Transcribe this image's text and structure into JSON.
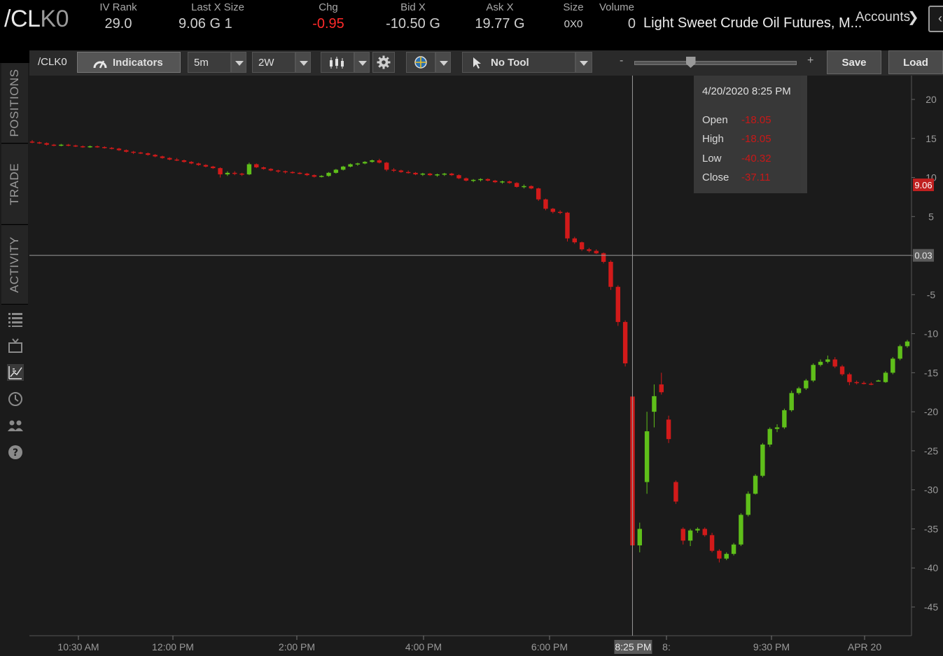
{
  "header": {
    "symbol_main": "/CL",
    "symbol_dim": "K0",
    "iv_rank_label": "IV Rank",
    "iv_rank_value": "29.0",
    "last_label": "Last X Size",
    "last_value": "9.06 G 1",
    "chg_label": "Chg",
    "chg_value": "-0.95",
    "bid_label": "Bid X",
    "bid_value": "-10.50 G",
    "ask_label": "Ask X",
    "ask_value": "19.77 G",
    "size_label": "Size",
    "size_value": "0X0",
    "volume_label": "Volume",
    "volume_value": "0",
    "description": "Light Sweet Crude Oil Futures, M...",
    "accounts_label": "Accounts"
  },
  "sidebar": {
    "tabs": [
      "POSITIONS",
      "TRADE",
      "ACTIVITY"
    ]
  },
  "toolbar": {
    "symbol": "/CLK0",
    "indicators_label": "Indicators",
    "aggregation": "5m",
    "time_frame": "2W",
    "drawing_tool": "No Tool",
    "zoom_minus": "-",
    "zoom_plus": "+",
    "zoom_level": 0.35,
    "save_label": "Save",
    "load_label": "Load"
  },
  "tooltip": {
    "date": "4/20/2020 8:25 PM",
    "open_label": "Open",
    "open_value": "-18.05",
    "high_label": "High",
    "high_value": "-18.05",
    "low_label": "Low",
    "low_value": "-40.32",
    "close_label": "Close",
    "close_value": "-37.11"
  },
  "colors": {
    "up": "#5fbf1a",
    "down": "#d21a1a",
    "last_price_badge": "#c02020",
    "crosshair_badge": "#5a5a5a"
  },
  "chart_data": {
    "type": "candlestick",
    "title": "/CLK0",
    "y_ticks": [
      20,
      15,
      10,
      5,
      0,
      -5,
      -10,
      -15,
      -20,
      -25,
      -30,
      -35,
      -40,
      -45
    ],
    "ylim": [
      -48,
      23
    ],
    "x_ticks": [
      "10:30 AM",
      "12:00 PM",
      "2:00 PM",
      "4:00 PM",
      "6:00 PM",
      "8:",
      "9:30 PM",
      "APR 20"
    ],
    "crosshair_x_label": "8:25 PM",
    "crosshair_y_label": "0.03",
    "last_price_label": "9.06",
    "candles": [
      [
        14.6,
        14.8,
        14.4,
        14.5
      ],
      [
        14.5,
        14.6,
        14.3,
        14.4
      ],
      [
        14.4,
        14.5,
        14.1,
        14.2
      ],
      [
        14.2,
        14.3,
        14.0,
        14.1
      ],
      [
        14.1,
        14.3,
        14.0,
        14.2
      ],
      [
        14.2,
        14.3,
        14.0,
        14.1
      ],
      [
        14.1,
        14.2,
        13.9,
        14.0
      ],
      [
        14.0,
        14.1,
        13.8,
        13.9
      ],
      [
        13.9,
        14.1,
        13.8,
        14.0
      ],
      [
        14.0,
        14.1,
        13.8,
        13.9
      ],
      [
        13.9,
        14.0,
        13.7,
        13.8
      ],
      [
        13.8,
        13.9,
        13.6,
        13.7
      ],
      [
        13.7,
        13.8,
        13.4,
        13.5
      ],
      [
        13.5,
        13.6,
        13.2,
        13.3
      ],
      [
        13.3,
        13.4,
        13.0,
        13.2
      ],
      [
        13.2,
        13.3,
        13.0,
        13.1
      ],
      [
        13.1,
        13.2,
        12.8,
        12.9
      ],
      [
        12.9,
        13.0,
        12.6,
        12.7
      ],
      [
        12.7,
        12.8,
        12.4,
        12.5
      ],
      [
        12.5,
        12.6,
        12.2,
        12.3
      ],
      [
        12.3,
        12.5,
        12.1,
        12.2
      ],
      [
        12.2,
        12.3,
        11.9,
        12.0
      ],
      [
        12.0,
        12.1,
        11.7,
        11.8
      ],
      [
        11.8,
        11.9,
        11.5,
        11.6
      ],
      [
        11.6,
        11.7,
        11.3,
        11.4
      ],
      [
        11.4,
        11.5,
        11.1,
        11.2
      ],
      [
        11.2,
        11.3,
        10.0,
        10.4
      ],
      [
        10.4,
        10.8,
        10.2,
        10.6
      ],
      [
        10.6,
        10.8,
        10.3,
        10.5
      ],
      [
        10.5,
        10.6,
        10.2,
        10.4
      ],
      [
        10.4,
        11.9,
        10.3,
        11.7
      ],
      [
        11.7,
        11.8,
        11.2,
        11.3
      ],
      [
        11.3,
        11.4,
        11.0,
        11.1
      ],
      [
        11.1,
        11.2,
        10.8,
        10.9
      ],
      [
        10.9,
        11.0,
        10.6,
        10.8
      ],
      [
        10.8,
        10.9,
        10.5,
        10.7
      ],
      [
        10.7,
        10.8,
        10.5,
        10.6
      ],
      [
        10.6,
        10.7,
        10.4,
        10.5
      ],
      [
        10.5,
        10.6,
        10.2,
        10.3
      ],
      [
        10.3,
        10.4,
        10.0,
        10.1
      ],
      [
        10.1,
        10.3,
        10.0,
        10.2
      ],
      [
        10.2,
        10.7,
        10.1,
        10.6
      ],
      [
        10.6,
        11.1,
        10.5,
        11.0
      ],
      [
        11.0,
        11.5,
        10.9,
        11.4
      ],
      [
        11.4,
        11.8,
        11.3,
        11.7
      ],
      [
        11.7,
        11.9,
        11.5,
        11.8
      ],
      [
        11.8,
        12.1,
        11.7,
        12.0
      ],
      [
        12.0,
        12.3,
        11.9,
        12.2
      ],
      [
        12.2,
        12.4,
        11.8,
        11.9
      ],
      [
        11.9,
        12.0,
        10.8,
        11.0
      ],
      [
        11.0,
        11.2,
        10.7,
        10.9
      ],
      [
        10.9,
        11.0,
        10.6,
        10.7
      ],
      [
        10.7,
        10.9,
        10.5,
        10.6
      ],
      [
        10.6,
        10.7,
        10.3,
        10.4
      ],
      [
        10.4,
        10.6,
        10.2,
        10.5
      ],
      [
        10.5,
        10.6,
        10.2,
        10.3
      ],
      [
        10.3,
        10.5,
        10.1,
        10.4
      ],
      [
        10.4,
        10.6,
        10.2,
        10.5
      ],
      [
        10.5,
        10.6,
        10.2,
        10.3
      ],
      [
        10.3,
        10.4,
        9.8,
        9.9
      ],
      [
        9.9,
        10.0,
        9.5,
        9.6
      ],
      [
        9.6,
        9.8,
        9.4,
        9.7
      ],
      [
        9.7,
        9.9,
        9.5,
        9.8
      ],
      [
        9.8,
        9.9,
        9.5,
        9.6
      ],
      [
        9.6,
        9.7,
        9.3,
        9.4
      ],
      [
        9.4,
        9.6,
        9.2,
        9.5
      ],
      [
        9.5,
        9.6,
        9.2,
        9.3
      ],
      [
        9.3,
        9.4,
        8.7,
        8.8
      ],
      [
        8.8,
        9.1,
        8.6,
        8.9
      ],
      [
        8.9,
        9.0,
        8.5,
        8.6
      ],
      [
        8.6,
        8.7,
        7.0,
        7.2
      ],
      [
        7.2,
        7.3,
        5.8,
        6.0
      ],
      [
        6.0,
        6.1,
        5.4,
        5.6
      ],
      [
        5.6,
        5.8,
        5.3,
        5.5
      ],
      [
        5.5,
        5.6,
        1.8,
        2.2
      ],
      [
        2.2,
        2.4,
        1.5,
        1.7
      ],
      [
        1.7,
        1.8,
        0.6,
        0.8
      ],
      [
        0.8,
        1.0,
        0.4,
        0.6
      ],
      [
        0.6,
        0.8,
        0.2,
        0.3
      ],
      [
        0.3,
        0.4,
        -1.0,
        -0.8
      ],
      [
        -0.8,
        -0.6,
        -4.4,
        -4.0
      ],
      [
        -4.0,
        -3.8,
        -9.0,
        -8.5
      ],
      [
        -8.5,
        -8.3,
        -14.2,
        -13.8
      ],
      [
        -18.05,
        -18.05,
        -40.32,
        -37.11
      ],
      [
        -37.11,
        -34.2,
        -38.0,
        -35.0
      ],
      [
        -29.0,
        -20.0,
        -30.5,
        -22.5
      ],
      [
        -20.0,
        -16.5,
        -22.0,
        -18.0
      ],
      [
        -16.5,
        -15.0,
        -17.8,
        -17.5
      ],
      [
        -21.0,
        -20.5,
        -24.0,
        -23.5
      ],
      [
        -29.0,
        -28.8,
        -31.8,
        -31.5
      ],
      [
        -35.0,
        -34.8,
        -37.0,
        -36.5
      ],
      [
        -36.5,
        -35.0,
        -37.2,
        -35.2
      ],
      [
        -35.2,
        -34.8,
        -35.5,
        -35.0
      ],
      [
        -35.0,
        -34.8,
        -36.0,
        -35.8
      ],
      [
        -35.8,
        -35.5,
        -38.0,
        -37.8
      ],
      [
        -37.8,
        -37.6,
        -39.3,
        -38.8
      ],
      [
        -38.8,
        -38.0,
        -39.0,
        -38.2
      ],
      [
        -38.2,
        -36.8,
        -38.4,
        -37.0
      ],
      [
        -37.0,
        -33.0,
        -37.2,
        -33.2
      ],
      [
        -33.2,
        -30.2,
        -33.4,
        -30.5
      ],
      [
        -30.5,
        -28.0,
        -30.6,
        -28.2
      ],
      [
        -28.2,
        -24.0,
        -28.4,
        -24.2
      ],
      [
        -24.2,
        -22.0,
        -24.5,
        -22.2
      ],
      [
        -22.2,
        -21.6,
        -22.6,
        -22.0
      ],
      [
        -22.0,
        -19.6,
        -22.2,
        -19.8
      ],
      [
        -19.8,
        -17.3,
        -20.0,
        -17.6
      ],
      [
        -17.6,
        -16.8,
        -17.8,
        -17.0
      ],
      [
        -17.0,
        -15.8,
        -17.2,
        -16.0
      ],
      [
        -16.0,
        -13.8,
        -16.2,
        -14.0
      ],
      [
        -14.0,
        -13.3,
        -14.2,
        -13.6
      ],
      [
        -13.6,
        -12.8,
        -13.8,
        -13.3
      ],
      [
        -13.3,
        -13.0,
        -14.4,
        -14.2
      ],
      [
        -14.2,
        -14.0,
        -15.4,
        -15.2
      ],
      [
        -15.2,
        -15.0,
        -16.6,
        -16.2
      ],
      [
        -16.2,
        -16.0,
        -16.5,
        -16.3
      ],
      [
        -16.3,
        -16.1,
        -16.5,
        -16.4
      ],
      [
        -16.4,
        -16.2,
        -16.6,
        -16.5
      ],
      [
        -16.0,
        -15.9,
        -16.1,
        -16.0
      ],
      [
        -16.2,
        -14.8,
        -16.3,
        -15.0
      ],
      [
        -15.0,
        -13.0,
        -15.2,
        -13.2
      ],
      [
        -13.2,
        -11.4,
        -13.4,
        -11.6
      ],
      [
        -11.6,
        -10.8,
        -11.8,
        -11.0
      ]
    ]
  }
}
